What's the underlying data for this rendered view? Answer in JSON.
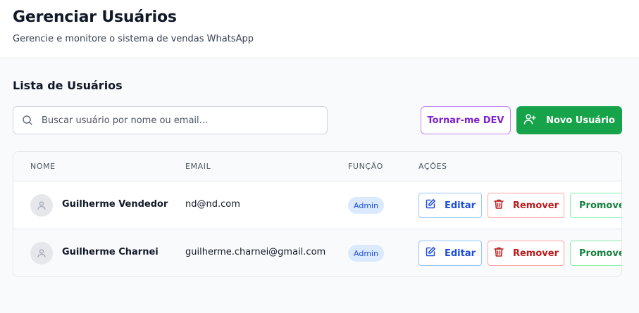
{
  "header": {
    "title": "Gerenciar Usuários",
    "subtitle": "Gerencie e monitore o sistema de vendas WhatsApp"
  },
  "section": {
    "title": "Lista de Usuários"
  },
  "search": {
    "placeholder": "Buscar usuário por nome ou email...",
    "value": "",
    "icon": "search-icon"
  },
  "toolbar": {
    "dev_label": "Tornar-me DEV",
    "new_user_label": "Novo Usuário",
    "new_user_icon": "user-plus-icon"
  },
  "table": {
    "columns": [
      "Nome",
      "Email",
      "Função",
      "Ações"
    ],
    "rows": [
      {
        "name": "Guilherme Vendedor",
        "email": "nd@nd.com",
        "role": "Admin"
      },
      {
        "name": "Guilherme Charnei",
        "email": "guilherme.charnei@gmail.com",
        "role": "Admin"
      }
    ],
    "actions": {
      "edit_label": "Editar",
      "remove_label": "Remover",
      "promote_label": "Promover"
    }
  },
  "colors": {
    "primary_green": "#16a34a",
    "dev_purple": "#7e22ce",
    "edit_blue": "#1d4ed8",
    "remove_red": "#b91c1c",
    "promote_green": "#15803d",
    "badge_bg": "#dbeafe"
  }
}
